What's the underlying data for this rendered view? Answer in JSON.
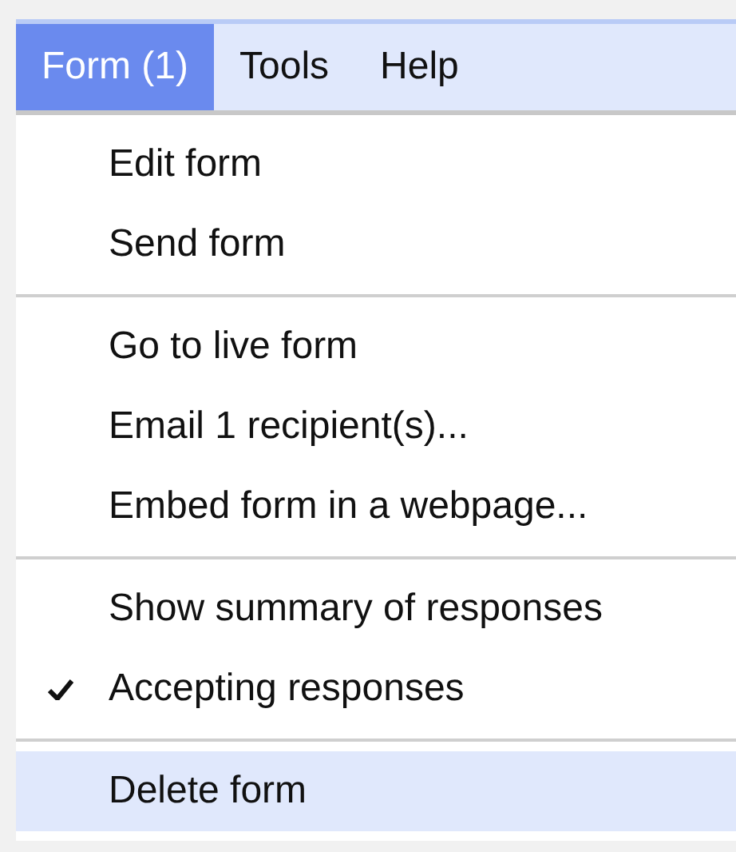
{
  "menubar": [
    {
      "label": "Form (1)",
      "selected": true
    },
    {
      "label": "Tools",
      "selected": false
    },
    {
      "label": "Help",
      "selected": false
    }
  ],
  "menu": {
    "groups": [
      {
        "items": [
          {
            "label": "Edit form",
            "checked": false,
            "highlighted": false
          },
          {
            "label": "Send form",
            "checked": false,
            "highlighted": false
          }
        ]
      },
      {
        "items": [
          {
            "label": "Go to live form",
            "checked": false,
            "highlighted": false
          },
          {
            "label": "Email 1 recipient(s)...",
            "checked": false,
            "highlighted": false
          },
          {
            "label": "Embed form in a webpage...",
            "checked": false,
            "highlighted": false
          }
        ]
      },
      {
        "items": [
          {
            "label": "Show summary of responses",
            "checked": false,
            "highlighted": false
          },
          {
            "label": "Accepting responses",
            "checked": true,
            "highlighted": false
          }
        ]
      },
      {
        "items": [
          {
            "label": "Delete form",
            "checked": false,
            "highlighted": true
          }
        ]
      }
    ]
  }
}
